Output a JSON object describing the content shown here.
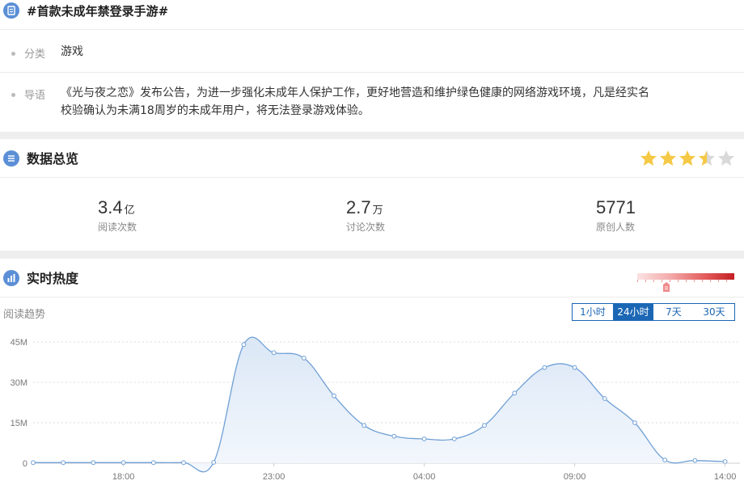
{
  "topic": {
    "title": "#首款未成年禁登录手游#",
    "category_label": "分类",
    "category_value": "游戏",
    "intro_label": "导语",
    "intro_line1": "《光与夜之恋》发布公告，为进一步强化未成年人保护工作，更好地营造和维护绿色健康的网络游戏环境，凡是经实名",
    "intro_line2": "校验确认为未满18周岁的未成年用户，将无法登录游戏体验。"
  },
  "overview": {
    "title": "数据总览",
    "rating_stars": 3.5,
    "rating_max": 5,
    "stats": [
      {
        "value": "3.4",
        "unit": "亿",
        "label": "阅读次数"
      },
      {
        "value": "2.7",
        "unit": "万",
        "label": "讨论次数"
      },
      {
        "value": "5771",
        "unit": "",
        "label": "原创人数"
      }
    ]
  },
  "heat": {
    "title": "实时热度",
    "heat_level_fraction": 0.3,
    "trend_label": "阅读趋势",
    "ranges": [
      "1小时",
      "24小时",
      "7天",
      "30天"
    ],
    "active_range": "24小时"
  },
  "colors": {
    "accent": "#1c67b5",
    "line": "#6f9fd6",
    "area": "#e7eff9",
    "star_on": "#f5c945",
    "star_off": "#d9d9d9"
  },
  "chart_data": {
    "type": "area",
    "ylabel": "",
    "xlabel": "",
    "y_ticks": [
      "0",
      "15M",
      "30M",
      "45M"
    ],
    "y_tick_values": [
      0,
      15,
      30,
      45
    ],
    "ylim": [
      0,
      48
    ],
    "x_ticks": [
      "18:00",
      "23:00",
      "04:00",
      "09:00",
      "14:00"
    ],
    "x_tick_index": [
      3,
      8,
      13,
      18,
      23
    ],
    "series": [
      {
        "values": [
          0.2,
          0.2,
          0.2,
          0.2,
          0.2,
          0.2,
          0.3,
          44,
          41,
          39,
          25,
          14,
          10,
          9,
          9,
          14,
          26,
          35.5,
          35.5,
          24,
          15,
          1.2,
          1.0,
          0.6
        ]
      }
    ],
    "grid": true
  }
}
